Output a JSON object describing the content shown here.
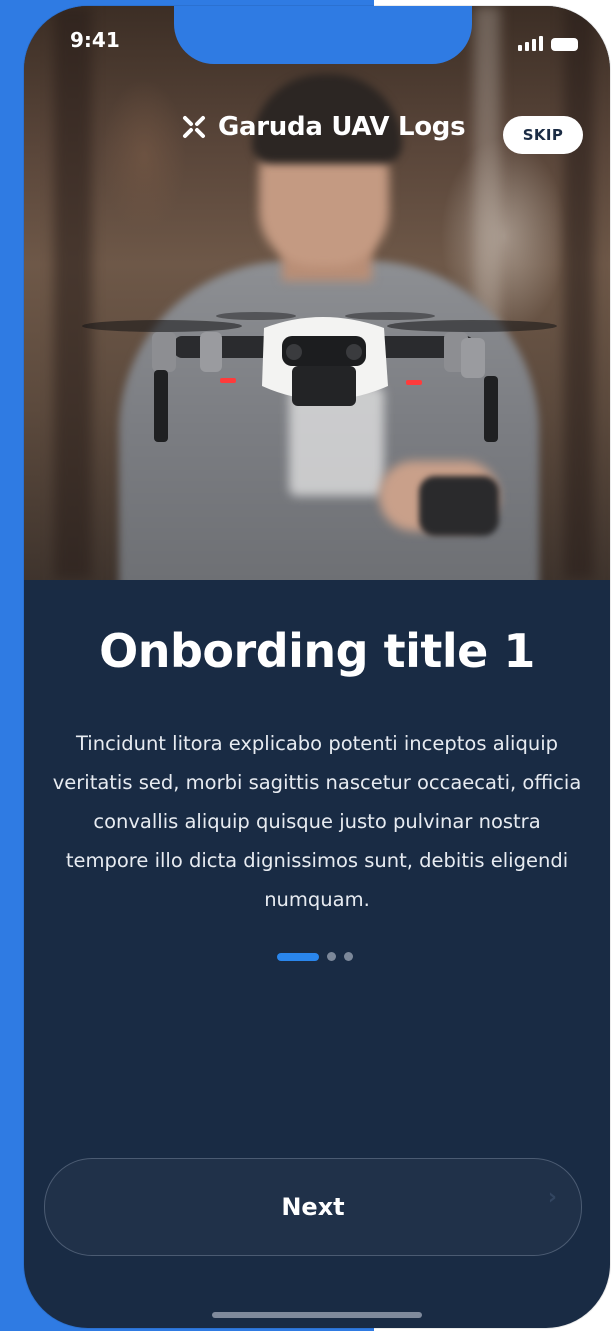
{
  "status_bar": {
    "time": "9:41"
  },
  "header": {
    "brand_icon": "drone-x-icon",
    "brand_name": "Garuda UAV Logs",
    "skip_label": "SKIP"
  },
  "hero": {
    "image": "drone-flying-photo"
  },
  "onboarding": {
    "title": "Onbording title 1",
    "description": "Tincidunt litora explicabo potenti inceptos aliquip veritatis sed, morbi sagittis nascetur occaecati, officia convallis aliquip quisque justo pulvinar nostra tempore illo dicta dignissimos sunt, debitis eligendi numquam.",
    "pager": {
      "current": 1,
      "total": 3
    }
  },
  "actions": {
    "next_label": "Next"
  },
  "colors": {
    "accent": "#2a86ec",
    "background": "#192b44",
    "side_panel": "#2f7be3"
  }
}
